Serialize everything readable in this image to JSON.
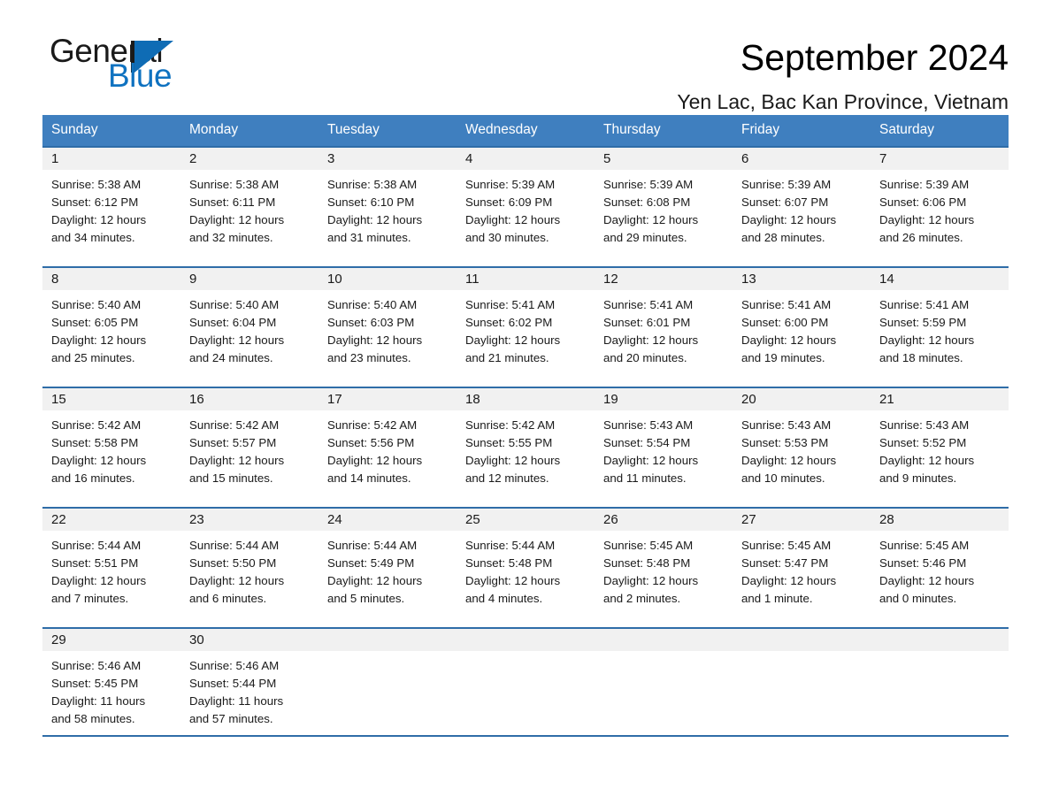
{
  "brand": {
    "name_part1": "General",
    "name_part2": "Blue",
    "triangle_color": "#0f6cb5",
    "blue_color": "#0f72c0"
  },
  "header": {
    "month_title": "September 2024",
    "location": "Yen Lac, Bac Kan Province, Vietnam"
  },
  "calendar": {
    "header_bg": "#3f7fbf",
    "day_band_bg": "#f1f1f1",
    "rule_color": "#2f6da8",
    "weekdays": [
      "Sunday",
      "Monday",
      "Tuesday",
      "Wednesday",
      "Thursday",
      "Friday",
      "Saturday"
    ],
    "weeks": [
      [
        {
          "date": "1",
          "sunrise": "Sunrise: 5:38 AM",
          "sunset": "Sunset: 6:12 PM",
          "daylight_line1": "Daylight: 12 hours",
          "daylight_line2": "and 34 minutes."
        },
        {
          "date": "2",
          "sunrise": "Sunrise: 5:38 AM",
          "sunset": "Sunset: 6:11 PM",
          "daylight_line1": "Daylight: 12 hours",
          "daylight_line2": "and 32 minutes."
        },
        {
          "date": "3",
          "sunrise": "Sunrise: 5:38 AM",
          "sunset": "Sunset: 6:10 PM",
          "daylight_line1": "Daylight: 12 hours",
          "daylight_line2": "and 31 minutes."
        },
        {
          "date": "4",
          "sunrise": "Sunrise: 5:39 AM",
          "sunset": "Sunset: 6:09 PM",
          "daylight_line1": "Daylight: 12 hours",
          "daylight_line2": "and 30 minutes."
        },
        {
          "date": "5",
          "sunrise": "Sunrise: 5:39 AM",
          "sunset": "Sunset: 6:08 PM",
          "daylight_line1": "Daylight: 12 hours",
          "daylight_line2": "and 29 minutes."
        },
        {
          "date": "6",
          "sunrise": "Sunrise: 5:39 AM",
          "sunset": "Sunset: 6:07 PM",
          "daylight_line1": "Daylight: 12 hours",
          "daylight_line2": "and 28 minutes."
        },
        {
          "date": "7",
          "sunrise": "Sunrise: 5:39 AM",
          "sunset": "Sunset: 6:06 PM",
          "daylight_line1": "Daylight: 12 hours",
          "daylight_line2": "and 26 minutes."
        }
      ],
      [
        {
          "date": "8",
          "sunrise": "Sunrise: 5:40 AM",
          "sunset": "Sunset: 6:05 PM",
          "daylight_line1": "Daylight: 12 hours",
          "daylight_line2": "and 25 minutes."
        },
        {
          "date": "9",
          "sunrise": "Sunrise: 5:40 AM",
          "sunset": "Sunset: 6:04 PM",
          "daylight_line1": "Daylight: 12 hours",
          "daylight_line2": "and 24 minutes."
        },
        {
          "date": "10",
          "sunrise": "Sunrise: 5:40 AM",
          "sunset": "Sunset: 6:03 PM",
          "daylight_line1": "Daylight: 12 hours",
          "daylight_line2": "and 23 minutes."
        },
        {
          "date": "11",
          "sunrise": "Sunrise: 5:41 AM",
          "sunset": "Sunset: 6:02 PM",
          "daylight_line1": "Daylight: 12 hours",
          "daylight_line2": "and 21 minutes."
        },
        {
          "date": "12",
          "sunrise": "Sunrise: 5:41 AM",
          "sunset": "Sunset: 6:01 PM",
          "daylight_line1": "Daylight: 12 hours",
          "daylight_line2": "and 20 minutes."
        },
        {
          "date": "13",
          "sunrise": "Sunrise: 5:41 AM",
          "sunset": "Sunset: 6:00 PM",
          "daylight_line1": "Daylight: 12 hours",
          "daylight_line2": "and 19 minutes."
        },
        {
          "date": "14",
          "sunrise": "Sunrise: 5:41 AM",
          "sunset": "Sunset: 5:59 PM",
          "daylight_line1": "Daylight: 12 hours",
          "daylight_line2": "and 18 minutes."
        }
      ],
      [
        {
          "date": "15",
          "sunrise": "Sunrise: 5:42 AM",
          "sunset": "Sunset: 5:58 PM",
          "daylight_line1": "Daylight: 12 hours",
          "daylight_line2": "and 16 minutes."
        },
        {
          "date": "16",
          "sunrise": "Sunrise: 5:42 AM",
          "sunset": "Sunset: 5:57 PM",
          "daylight_line1": "Daylight: 12 hours",
          "daylight_line2": "and 15 minutes."
        },
        {
          "date": "17",
          "sunrise": "Sunrise: 5:42 AM",
          "sunset": "Sunset: 5:56 PM",
          "daylight_line1": "Daylight: 12 hours",
          "daylight_line2": "and 14 minutes."
        },
        {
          "date": "18",
          "sunrise": "Sunrise: 5:42 AM",
          "sunset": "Sunset: 5:55 PM",
          "daylight_line1": "Daylight: 12 hours",
          "daylight_line2": "and 12 minutes."
        },
        {
          "date": "19",
          "sunrise": "Sunrise: 5:43 AM",
          "sunset": "Sunset: 5:54 PM",
          "daylight_line1": "Daylight: 12 hours",
          "daylight_line2": "and 11 minutes."
        },
        {
          "date": "20",
          "sunrise": "Sunrise: 5:43 AM",
          "sunset": "Sunset: 5:53 PM",
          "daylight_line1": "Daylight: 12 hours",
          "daylight_line2": "and 10 minutes."
        },
        {
          "date": "21",
          "sunrise": "Sunrise: 5:43 AM",
          "sunset": "Sunset: 5:52 PM",
          "daylight_line1": "Daylight: 12 hours",
          "daylight_line2": "and 9 minutes."
        }
      ],
      [
        {
          "date": "22",
          "sunrise": "Sunrise: 5:44 AM",
          "sunset": "Sunset: 5:51 PM",
          "daylight_line1": "Daylight: 12 hours",
          "daylight_line2": "and 7 minutes."
        },
        {
          "date": "23",
          "sunrise": "Sunrise: 5:44 AM",
          "sunset": "Sunset: 5:50 PM",
          "daylight_line1": "Daylight: 12 hours",
          "daylight_line2": "and 6 minutes."
        },
        {
          "date": "24",
          "sunrise": "Sunrise: 5:44 AM",
          "sunset": "Sunset: 5:49 PM",
          "daylight_line1": "Daylight: 12 hours",
          "daylight_line2": "and 5 minutes."
        },
        {
          "date": "25",
          "sunrise": "Sunrise: 5:44 AM",
          "sunset": "Sunset: 5:48 PM",
          "daylight_line1": "Daylight: 12 hours",
          "daylight_line2": "and 4 minutes."
        },
        {
          "date": "26",
          "sunrise": "Sunrise: 5:45 AM",
          "sunset": "Sunset: 5:48 PM",
          "daylight_line1": "Daylight: 12 hours",
          "daylight_line2": "and 2 minutes."
        },
        {
          "date": "27",
          "sunrise": "Sunrise: 5:45 AM",
          "sunset": "Sunset: 5:47 PM",
          "daylight_line1": "Daylight: 12 hours",
          "daylight_line2": "and 1 minute."
        },
        {
          "date": "28",
          "sunrise": "Sunrise: 5:45 AM",
          "sunset": "Sunset: 5:46 PM",
          "daylight_line1": "Daylight: 12 hours",
          "daylight_line2": "and 0 minutes."
        }
      ],
      [
        {
          "date": "29",
          "sunrise": "Sunrise: 5:46 AM",
          "sunset": "Sunset: 5:45 PM",
          "daylight_line1": "Daylight: 11 hours",
          "daylight_line2": "and 58 minutes."
        },
        {
          "date": "30",
          "sunrise": "Sunrise: 5:46 AM",
          "sunset": "Sunset: 5:44 PM",
          "daylight_line1": "Daylight: 11 hours",
          "daylight_line2": "and 57 minutes."
        },
        {
          "date": "",
          "sunrise": "",
          "sunset": "",
          "daylight_line1": "",
          "daylight_line2": ""
        },
        {
          "date": "",
          "sunrise": "",
          "sunset": "",
          "daylight_line1": "",
          "daylight_line2": ""
        },
        {
          "date": "",
          "sunrise": "",
          "sunset": "",
          "daylight_line1": "",
          "daylight_line2": ""
        },
        {
          "date": "",
          "sunrise": "",
          "sunset": "",
          "daylight_line1": "",
          "daylight_line2": ""
        },
        {
          "date": "",
          "sunrise": "",
          "sunset": "",
          "daylight_line1": "",
          "daylight_line2": ""
        }
      ]
    ]
  }
}
